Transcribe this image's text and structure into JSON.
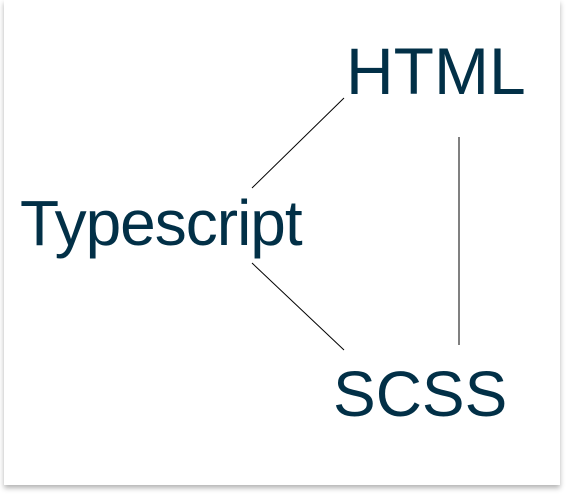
{
  "diagram": {
    "nodes": [
      {
        "id": "html",
        "label": "HTML"
      },
      {
        "id": "typescript",
        "label": "Typescript"
      },
      {
        "id": "scss",
        "label": "SCSS"
      }
    ],
    "edges": [
      {
        "from": "typescript",
        "to": "html"
      },
      {
        "from": "html",
        "to": "scss"
      },
      {
        "from": "typescript",
        "to": "scss"
      }
    ],
    "text_color": "#023047",
    "line_color": "#000000"
  }
}
